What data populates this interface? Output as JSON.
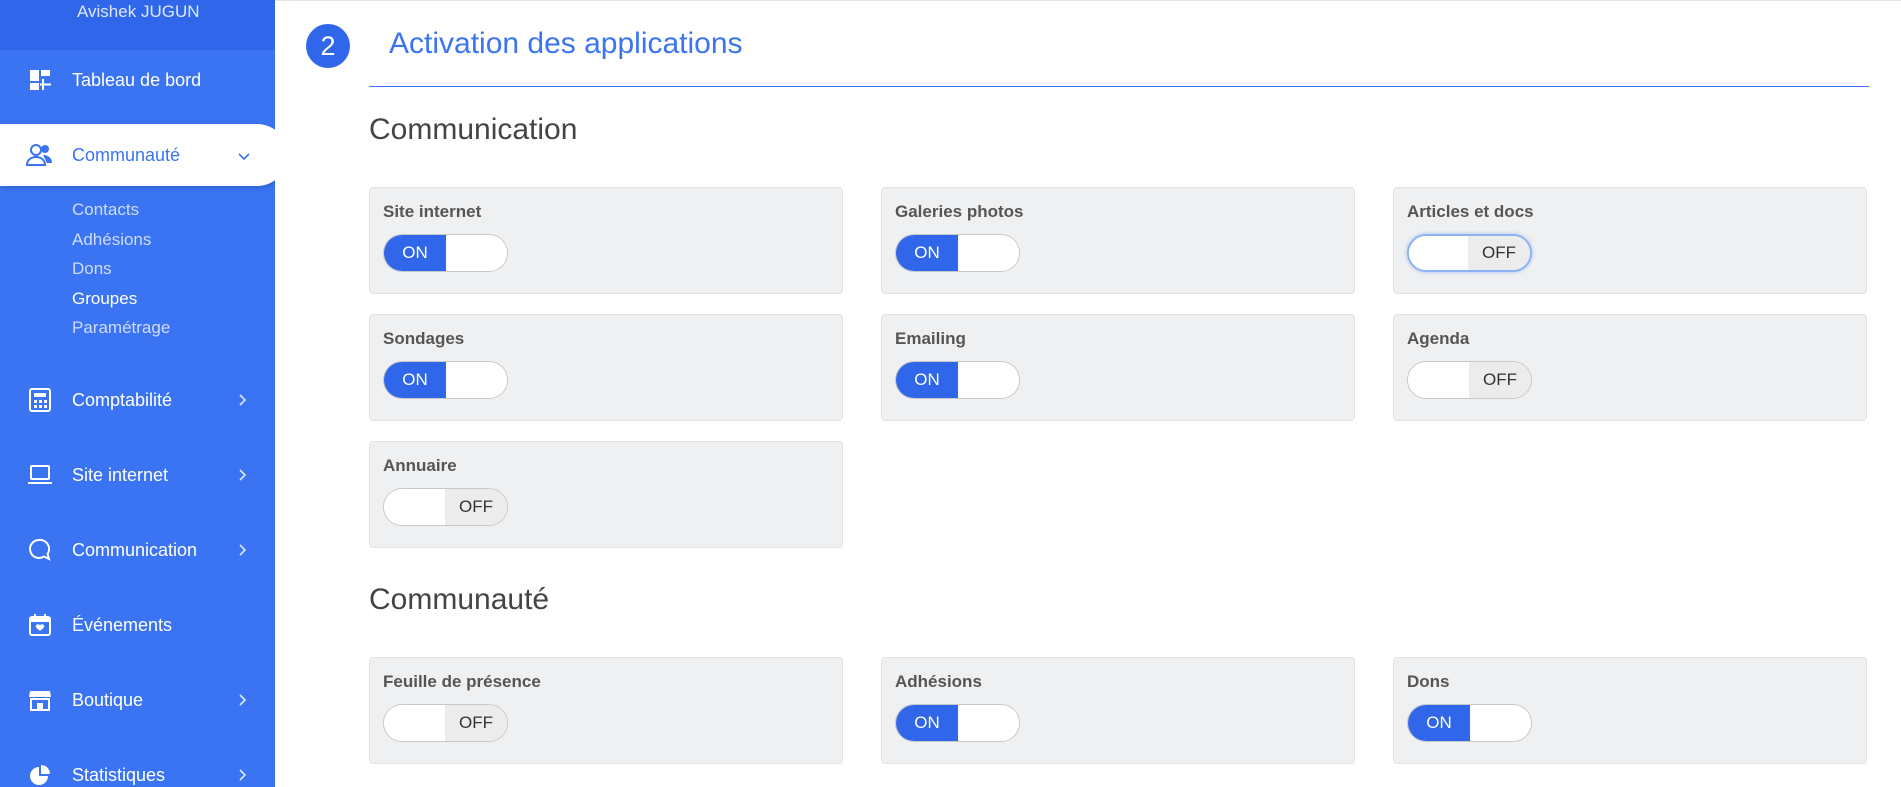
{
  "sidebar": {
    "user_name": "Avishek JUGUN",
    "items": [
      {
        "label": "Tableau de bord",
        "icon": "dashboard-icon"
      },
      {
        "label": "Communauté",
        "icon": "community-icon",
        "active": true
      },
      {
        "label": "Comptabilité",
        "icon": "calculator-icon"
      },
      {
        "label": "Site internet",
        "icon": "laptop-icon"
      },
      {
        "label": "Communication",
        "icon": "chat-icon"
      },
      {
        "label": "Événements",
        "icon": "calendar-icon"
      },
      {
        "label": "Boutique",
        "icon": "store-icon"
      },
      {
        "label": "Statistiques",
        "icon": "pie-chart-icon"
      }
    ],
    "subitems": [
      "Contacts",
      "Adhésions",
      "Dons",
      "Groupes",
      "Paramétrage"
    ]
  },
  "main": {
    "step_number": "2",
    "title": "Activation des applications",
    "sections": [
      {
        "title": "Communication",
        "apps": [
          {
            "label": "Site internet",
            "state": "ON"
          },
          {
            "label": "Galeries photos",
            "state": "ON"
          },
          {
            "label": "Articles et docs",
            "state": "OFF"
          },
          {
            "label": "Sondages",
            "state": "ON"
          },
          {
            "label": "Emailing",
            "state": "ON"
          },
          {
            "label": "Agenda",
            "state": "OFF"
          },
          {
            "label": "Annuaire",
            "state": "OFF"
          }
        ]
      },
      {
        "title": "Communauté",
        "apps": [
          {
            "label": "Feuille de présence",
            "state": "OFF"
          },
          {
            "label": "Adhésions",
            "state": "ON"
          },
          {
            "label": "Dons",
            "state": "ON"
          }
        ]
      }
    ]
  },
  "colors": {
    "accent": "#3a74f2",
    "sidebar": "#3a74f2",
    "card": "#eff0f1"
  }
}
